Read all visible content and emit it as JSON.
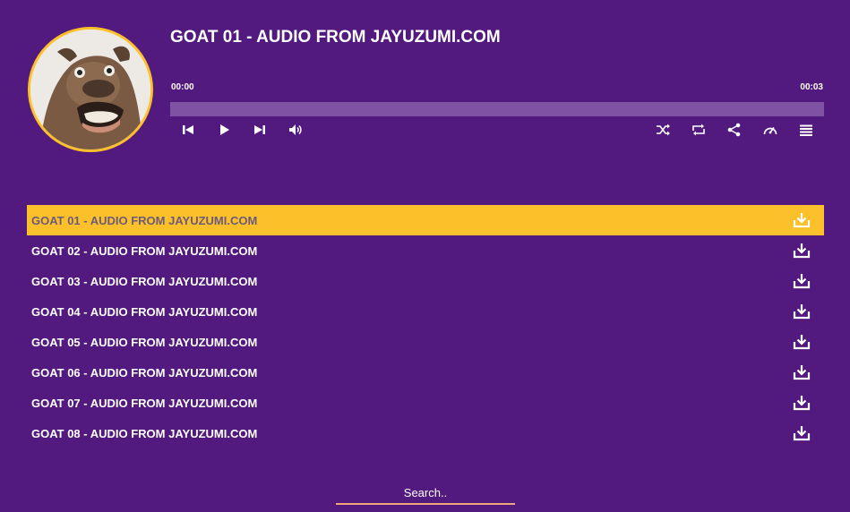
{
  "player": {
    "title": "GOAT 01 - AUDIO FROM JAYUZUMI.COM",
    "current_time": "00:00",
    "duration": "00:03",
    "progress_fraction": 0.0,
    "artwork_icon": "goat-photo",
    "controls_left": [
      "previous-icon",
      "play-icon",
      "next-icon",
      "volume-icon"
    ],
    "controls_right": [
      "shuffle-icon",
      "repeat-icon",
      "share-icon",
      "speed-icon",
      "playlist-icon"
    ]
  },
  "playlist": {
    "active_index": 0,
    "items": [
      {
        "title": "GOAT 01 - AUDIO FROM JAYUZUMI.COM"
      },
      {
        "title": "GOAT 02 - AUDIO FROM JAYUZUMI.COM"
      },
      {
        "title": "GOAT 03 - AUDIO FROM JAYUZUMI.COM"
      },
      {
        "title": "GOAT 04 - AUDIO FROM JAYUZUMI.COM"
      },
      {
        "title": "GOAT 05 - AUDIO FROM JAYUZUMI.COM"
      },
      {
        "title": "GOAT 06 - AUDIO FROM JAYUZUMI.COM"
      },
      {
        "title": "GOAT 07 - AUDIO FROM JAYUZUMI.COM"
      },
      {
        "title": "GOAT 08 - AUDIO FROM JAYUZUMI.COM"
      }
    ]
  },
  "search": {
    "placeholder": "Search.."
  },
  "colors": {
    "background": "#52197e",
    "accent": "#fcc02a",
    "progress_track": "#7f52a4",
    "search_underline": "#f0a57a"
  }
}
